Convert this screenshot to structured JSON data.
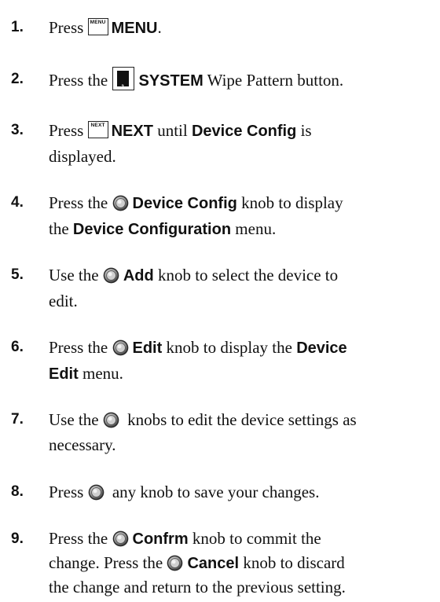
{
  "icons": {
    "menu_key": "MENU",
    "next_key": "NEXT",
    "pad_number": "2",
    "knob": "rotary-knob-icon"
  },
  "steps": [
    {
      "number": "1.",
      "t1": "Press ",
      "b1": "MENU",
      "t2": "."
    },
    {
      "number": "2.",
      "t1": "Press the ",
      "b1": "SYSTEM",
      "t2": " Wipe Pattern button."
    },
    {
      "number": "3.",
      "t1": "Press ",
      "b1": "NEXT",
      "t2": " until ",
      "b2": "Device Config",
      "t3": " is",
      "line2": "displayed."
    },
    {
      "number": "4.",
      "t1": "Press the ",
      "b1": "Device Config",
      "t2": " knob to display",
      "l2a": "the ",
      "l2b": "Device Configuration",
      "l2c": " menu."
    },
    {
      "number": "5.",
      "t1": "Use the ",
      "b1": "Add",
      "t2": " knob to select the device to",
      "line2": "edit."
    },
    {
      "number": "6.",
      "t1": "Press the ",
      "b1": "Edit",
      "t2": " knob to display the ",
      "b2": "Device",
      "l2b": "Edit",
      "l2c": " menu."
    },
    {
      "number": "7.",
      "t1": "Use the ",
      "t2": " knobs to edit the device settings as",
      "line2": "necessary."
    },
    {
      "number": "8.",
      "t1": "Press ",
      "t2": " any knob to save your changes."
    },
    {
      "number": "9.",
      "t1": "Press the ",
      "b1": "Confrm",
      "t2": " knob to commit the",
      "l2a": "change. Press the ",
      "l2b": "Cancel",
      "l2c": " knob to discard",
      "line3": "the change and return to the previous setting."
    }
  ]
}
